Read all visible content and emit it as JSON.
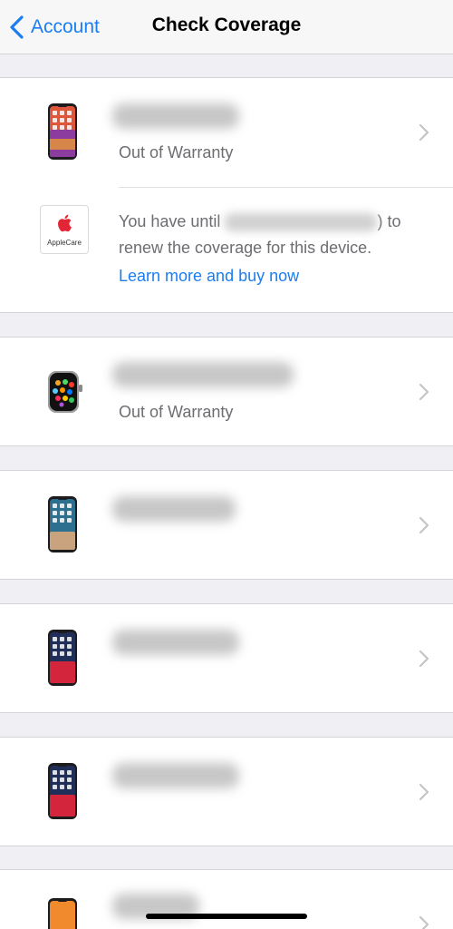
{
  "nav": {
    "back_label": "Account",
    "title": "Check Coverage"
  },
  "devices": [
    {
      "icon": "iphone-colorful-icon",
      "status": "Out of Warranty"
    },
    {
      "icon": "apple-watch-icon",
      "status": "Out of Warranty"
    },
    {
      "icon": "iphone-x-icon",
      "status": ""
    },
    {
      "icon": "iphone-xs-red-icon",
      "status": ""
    },
    {
      "icon": "iphone-xs-red-icon",
      "status": ""
    },
    {
      "icon": "iphone-orange-icon",
      "status": ""
    }
  ],
  "applecare": {
    "badge_label": "AppleCare",
    "text_before": "You have until",
    "text_after": ") to renew the coverage for this device.",
    "link": "Learn more and buy now"
  },
  "colors": {
    "accent": "#1a7ef0",
    "secondary_text": "#6d6d72",
    "background": "#efeff4"
  }
}
